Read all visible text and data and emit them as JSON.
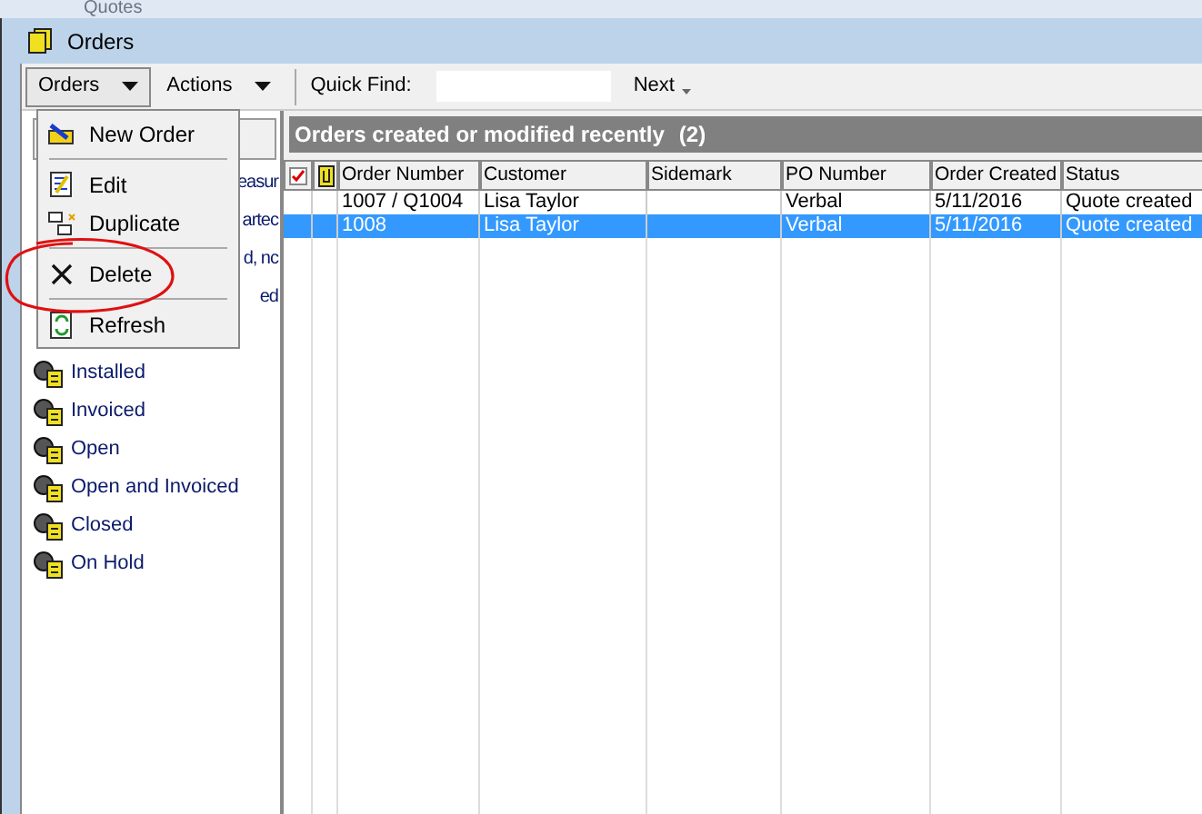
{
  "background_window": {
    "title": "Quotes"
  },
  "window": {
    "title": "Orders"
  },
  "toolbar": {
    "menus": [
      {
        "label": "Orders",
        "selected": true
      },
      {
        "label": "Actions",
        "selected": false
      }
    ],
    "quick_find": {
      "label": "Quick Find:"
    },
    "next": "Next"
  },
  "sidebar": {
    "items": [
      {
        "kind": "covered",
        "label": "easur"
      },
      {
        "kind": "covered",
        "label": "artec"
      },
      {
        "kind": "covered",
        "label": "d, nc"
      },
      {
        "kind": "covered",
        "label": "ed"
      },
      {
        "kind": "item",
        "label": "Installed"
      },
      {
        "kind": "item",
        "label": "Invoiced"
      },
      {
        "kind": "item",
        "label": "Open"
      },
      {
        "kind": "item",
        "label": "Open and Invoiced"
      },
      {
        "kind": "item",
        "label": "Closed"
      },
      {
        "kind": "item",
        "label": "On Hold"
      }
    ]
  },
  "grid": {
    "title": "Orders created or modified recently",
    "count": "(2)",
    "columns": [
      "Order Number",
      "Customer",
      "Sidemark",
      "PO Number",
      "Order Created",
      "Status"
    ],
    "rows": [
      {
        "selected": false,
        "cells": [
          "1007 / Q1004",
          "Lisa Taylor",
          "",
          "Verbal",
          "5/11/2016",
          "Quote created"
        ]
      },
      {
        "selected": true,
        "cells": [
          "1008",
          "Lisa Taylor",
          "",
          "Verbal",
          "5/11/2016",
          "Quote created"
        ]
      }
    ]
  },
  "menu": {
    "items": [
      {
        "kind": "item",
        "label": "New Order"
      },
      {
        "kind": "separator"
      },
      {
        "kind": "item",
        "label": "Edit"
      },
      {
        "kind": "item",
        "label": "Duplicate"
      },
      {
        "kind": "separator"
      },
      {
        "kind": "item",
        "label": "Delete"
      },
      {
        "kind": "separator"
      },
      {
        "kind": "item",
        "label": "Refresh"
      }
    ]
  }
}
